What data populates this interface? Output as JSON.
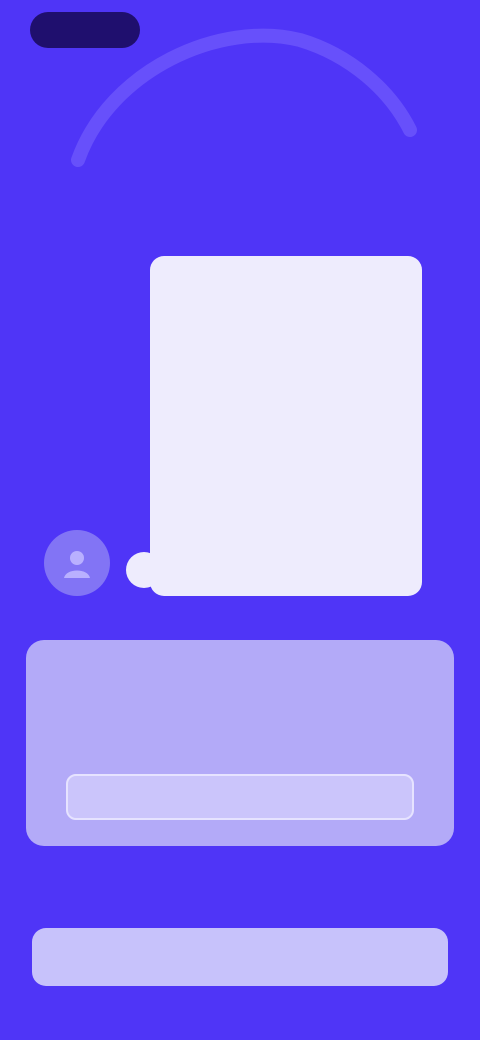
{
  "status": {
    "pill_label": ""
  },
  "header": {
    "caption": ""
  },
  "chat": {
    "message": ""
  },
  "card": {
    "title": "",
    "body": "",
    "button_label": ""
  },
  "footer": {
    "button_label": ""
  },
  "colors": {
    "background": "#4f35f7",
    "bubble": "#eeecfd",
    "card": "#b3aaf8",
    "button": "#c7c2fb",
    "pill": "#1f0f6e"
  },
  "icons": {
    "avatar": "person-icon",
    "progress_arc": "progress-arc-icon"
  }
}
